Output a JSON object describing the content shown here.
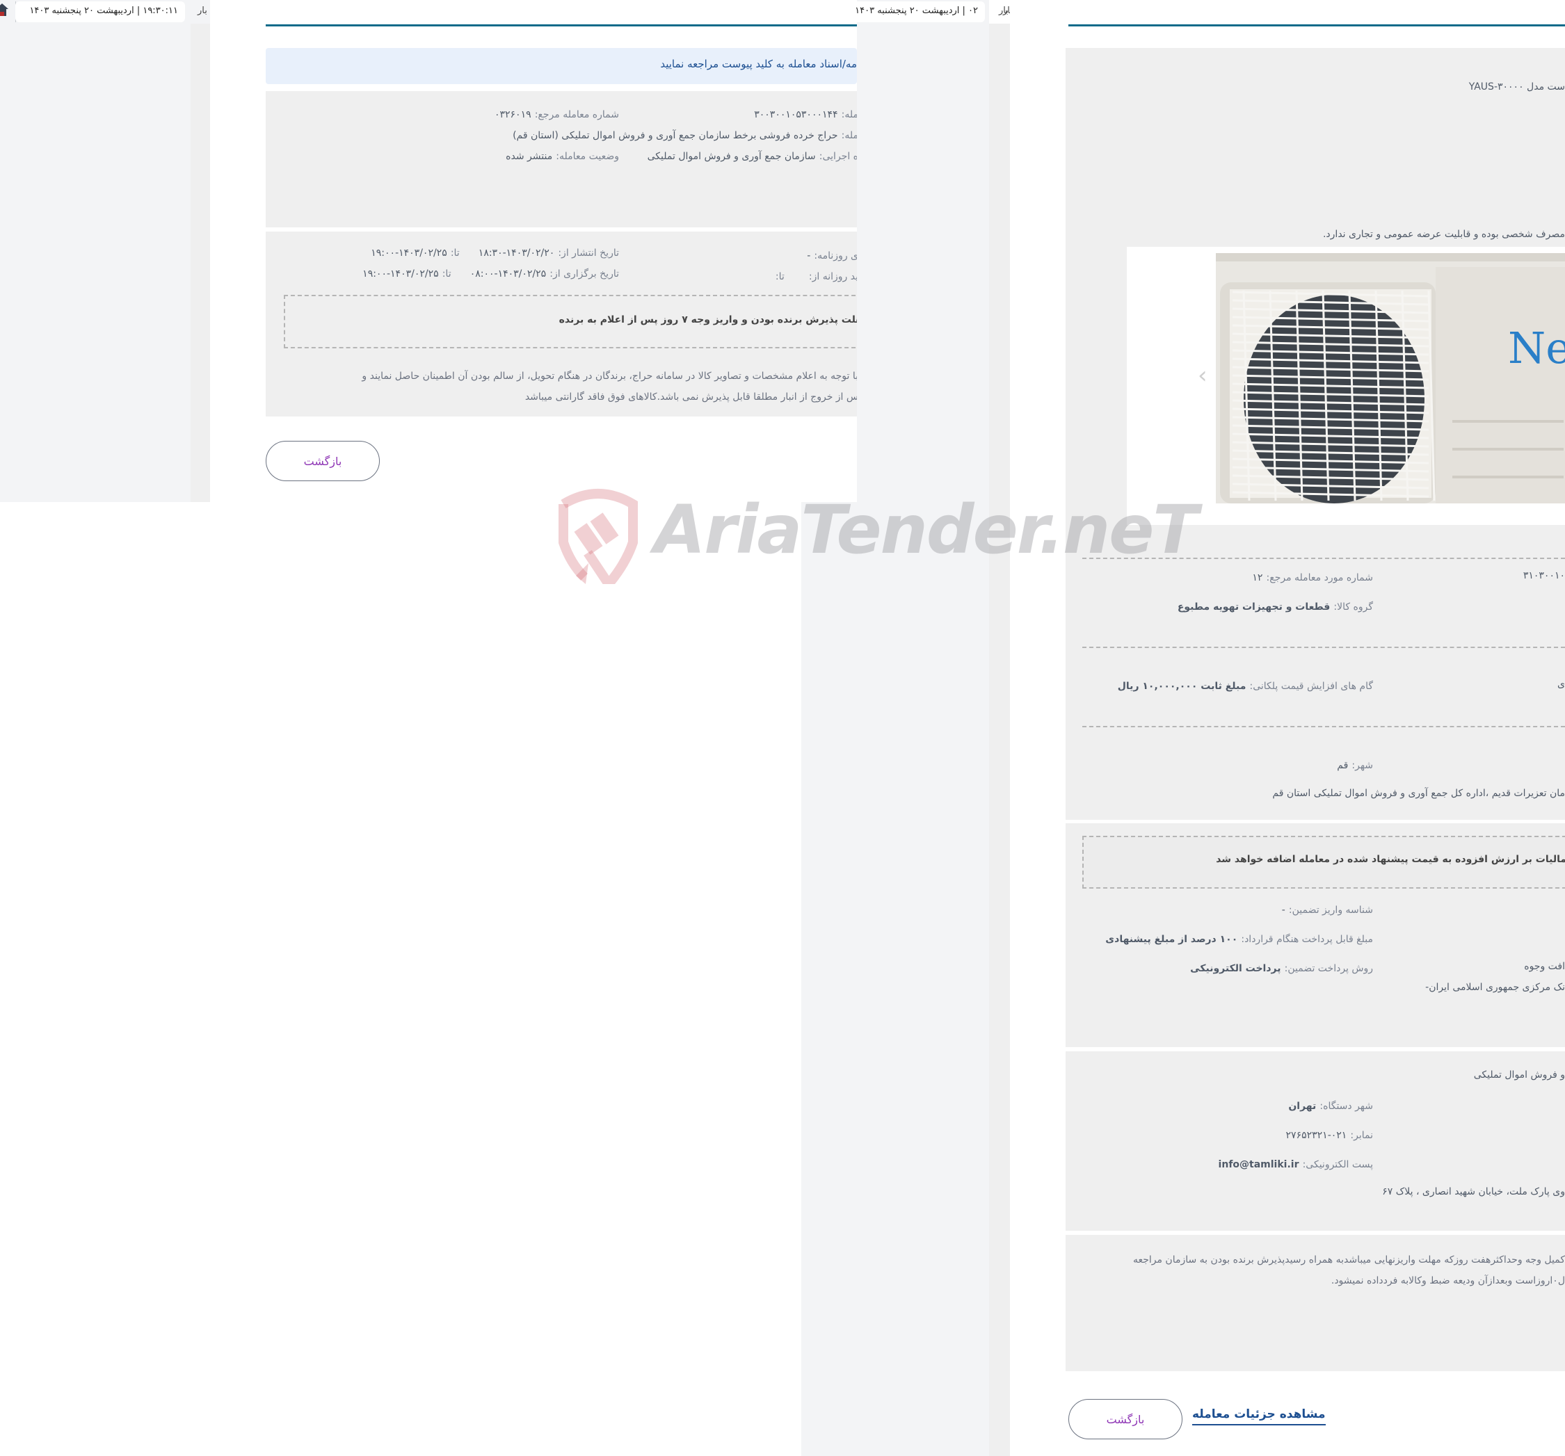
{
  "header": {
    "clock_left": "۱۹:۳۰:۱۱   |   اردیبهشت ۲۰ پنجشنبه ۱۴۰۳",
    "clock_mid": "۰۲   |   اردیبهشت ۲۰ پنجشنبه ۱۴۰۳",
    "bar_text": "بار"
  },
  "auction_page": {
    "notice": "مه/اسناد معامله به کلید پیوست مراجعه نمایید",
    "info": {
      "deal_number_label": "مله:",
      "deal_number_value": "۳۰۰۳۰۰۱۰۵۳۰۰۰۱۴۴",
      "ref_number_label": "شماره معامله مرجع:",
      "ref_number_value": "۰۳۲۶۰۱۹",
      "title_label": "مله:",
      "title_value": "حراج خرده فروشی برخط سازمان جمع آوری و فروش اموال تملیکی (استان قم)",
      "executor_label": "ه اجرایی:",
      "executor_value": "سازمان جمع آوری و فروش اموال تملیکی",
      "status_label": "وضعیت معامله:",
      "status_value": "منتشر شده"
    },
    "dates": {
      "newspaper_label": "ی روزنامه:",
      "newspaper_value": "-",
      "daily_label": "ید روزانه از:",
      "daily_to_label": "تا:",
      "publish_label": "تاریخ انتشار از:",
      "publish_from": "۱۴۰۳/۰۲/۲۰-۱۸:۳۰",
      "publish_to_label": "تا:",
      "publish_to": "۱۴۰۳/۰۲/۲۵-۱۹:۰۰",
      "hold_label": "تاریخ برگزاری از:",
      "hold_from": "۱۴۰۳/۰۲/۲۵-۰۸:۰۰",
      "hold_to_label": "تا:",
      "hold_to": "۱۴۰۳/۰۲/۲۵-۱۹:۰۰"
    },
    "deadline_note": "هلت پذیرش برنده بودن و واریز وجه ۷ روز پس از اعلام به برنده",
    "description_line1": "با توجه به اعلام مشخصات و تصاویر کالا در سامانه حراج، برندگان در هنگام تحویل، از سالم بودن آن اطمینان حاصل نمایند و",
    "description_line2": "س از خروج از انبار مطلقا قابل پذیرش نمی باشد.کالاهای فوق فاقد گارانتی میباشد",
    "back_label": "بازگشت"
  },
  "item_page": {
    "model_text": "ست مدل YAUS-۳۰۰۰۰",
    "usage_note": "مصرف شخصی بوده و قابلیت عرضه عمومی و تجاری ندارد.",
    "image_alt": "Next air conditioner outdoor unit",
    "brand_on_image": "Next",
    "item_number_partial": "۳۱۰۳۰۰۱۰",
    "ref_item_label": "شماره مورد معامله مرجع:",
    "ref_item_value": "۱۲",
    "group_label": "گروه کالا:",
    "group_value": "قطعات و تجهیزات تهویه مطبوع",
    "step_label": "گام های افزایش قیمت پلکانی:",
    "step_value": "مبلغ ثابت ۱۰,۰۰۰,۰۰۰ ریال",
    "step_partial_right": "ی",
    "city_label": "شهر:",
    "city_value": "قم",
    "address_value": "مان تعزیرات قدیم ،اداره کل جمع آوری و فروش اموال تملیکی استان قم",
    "vat_note": "مالیات بر ارزش افزوده به قیمت پیشنهاد شده در معامله اضافه خواهد شد",
    "guarantee_id_label": "شناسه واریز تضمین:",
    "guarantee_id_value": "-",
    "payable_label": "مبلغ قابل پرداخت هنگام قرارداد:",
    "payable_value": "۱۰۰ درصد از مبلغ پیشنهادی",
    "payment_method_label": "روش پرداخت تضمین:",
    "payment_method_value": "پرداخت الکترونیکی",
    "receive_partial": "افت وجوه",
    "bank_partial": "نک مرکزی جمهوری اسلامی ایران-",
    "org_partial": "و فروش اموال تملیکی",
    "org_city_label": "شهر دستگاه:",
    "org_city_value": "تهران",
    "fax_label": "نمابر:",
    "fax_value": "۰۲۱-۲۷۶۵۲۳۲۱",
    "email_label": "پست الکترونیکی:",
    "email_value": "info@tamliki.ir",
    "org_address_partial": "وی پارک ملت، خیابان شهید انصاری ، پلاک ۶۷",
    "terms_line1": "کمیل وجه وحداکثرهفت روزکه مهلت واریزنهایی میباشدبه همراه رسیدپذیرش برنده بودن به سازمان مراجعه",
    "terms_line2": "ل۰اروزاست وبعدازآن ودیعه ضبط وکالابه فردداده نمیشود.",
    "back_label": "بازگشت",
    "details_link": "مشاهده جزئیات معامله"
  },
  "watermark": {
    "text": "AriaTender.neT"
  }
}
